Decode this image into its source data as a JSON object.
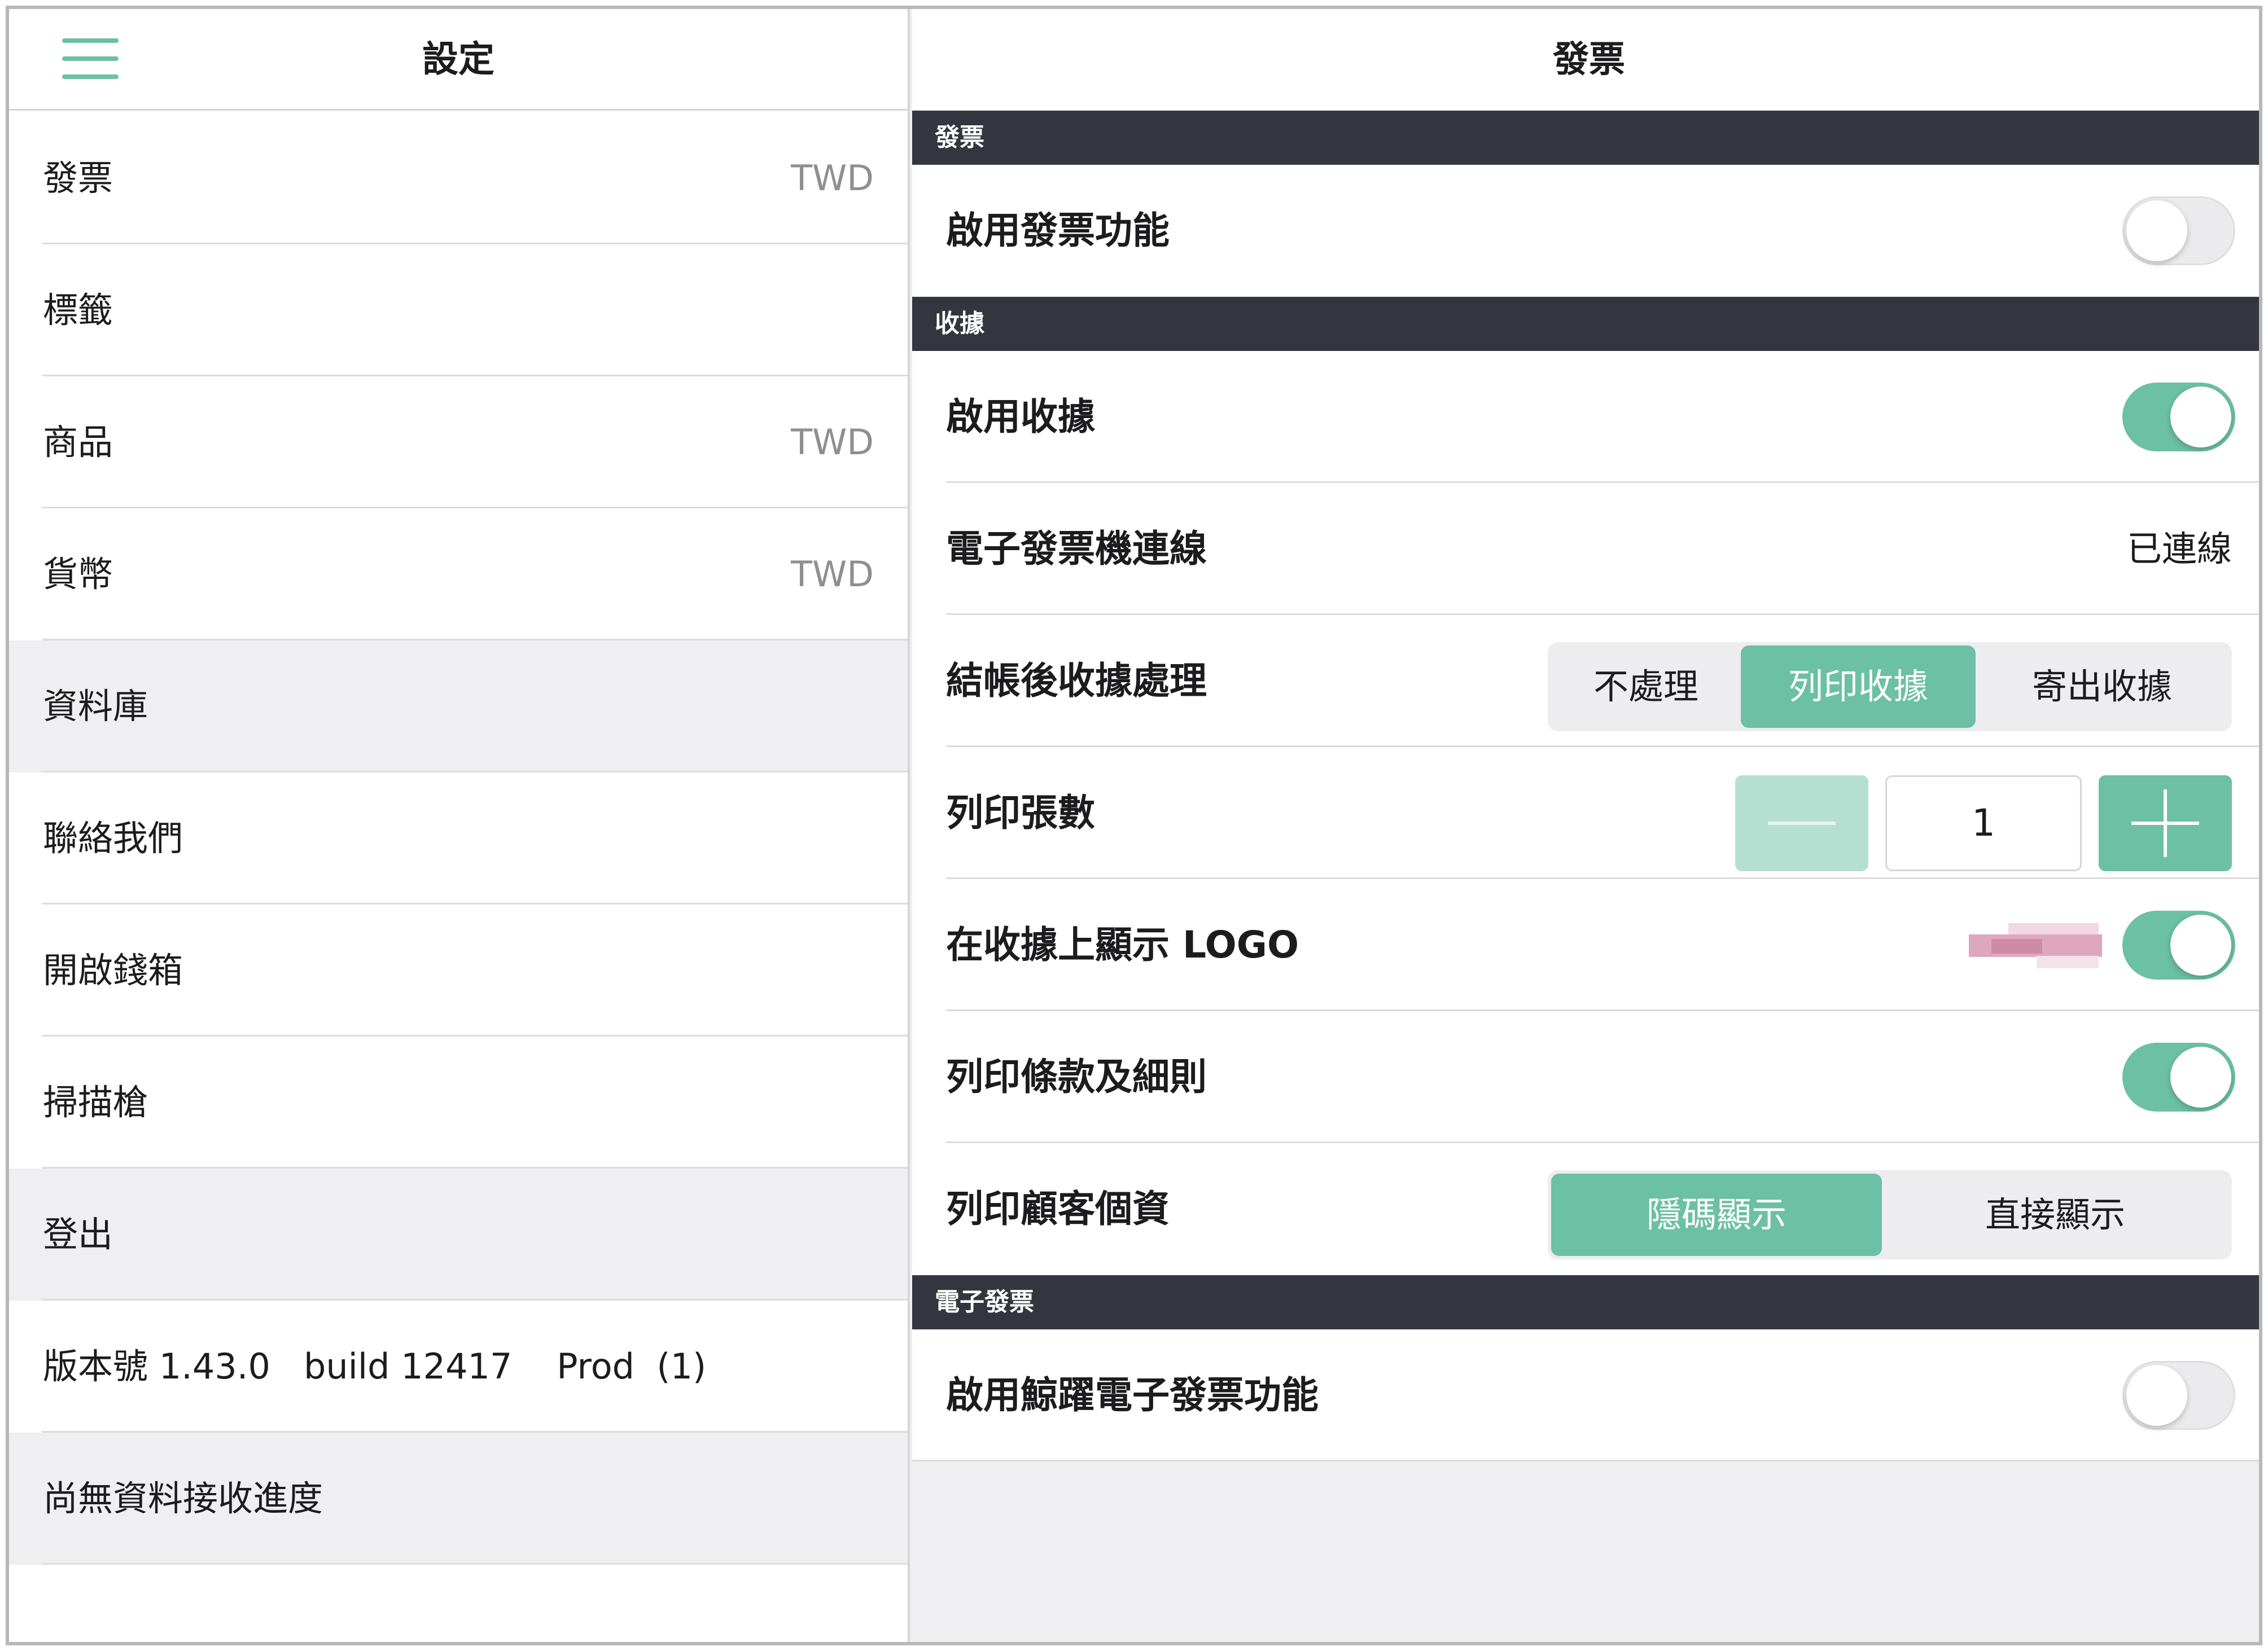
{
  "left": {
    "title": "設定",
    "items": [
      {
        "label": "發票",
        "value": "TWD"
      },
      {
        "label": "標籤",
        "value": ""
      },
      {
        "label": "商品",
        "value": "TWD"
      },
      {
        "label": "貨幣",
        "value": "TWD"
      },
      {
        "label": "資料庫",
        "value": ""
      },
      {
        "label": "聯絡我們",
        "value": ""
      },
      {
        "label": "開啟錢箱",
        "value": ""
      },
      {
        "label": "掃描槍",
        "value": ""
      },
      {
        "label": "登出",
        "value": ""
      },
      {
        "label": "版本號 1.43.0   build 12417    Prod  (1)",
        "value": ""
      },
      {
        "label": "尚無資料接收進度",
        "value": ""
      }
    ]
  },
  "right": {
    "title": "發票",
    "sections": {
      "invoice": "發票",
      "receipt": "收據",
      "einvoice": "電子發票"
    },
    "enable_invoice": {
      "label": "啟用發票功能",
      "on": false
    },
    "enable_receipt": {
      "label": "啟用收據",
      "on": true
    },
    "einvoice_connection": {
      "label": "電子發票機連線",
      "status": "已連線"
    },
    "after_checkout": {
      "label": "結帳後收據處理",
      "options": [
        "不處理",
        "列印收據",
        "寄出收據"
      ],
      "selected": "列印收據"
    },
    "print_copies": {
      "label": "列印張數",
      "value": "1"
    },
    "show_logo": {
      "label": "在收據上顯示 LOGO",
      "on": true
    },
    "print_terms": {
      "label": "列印條款及細則",
      "on": true
    },
    "print_customer": {
      "label": "列印顧客個資",
      "options": [
        "隱碼顯示",
        "直接顯示"
      ],
      "selected": "隱碼顯示"
    },
    "enable_whale_einvoice": {
      "label": "啟用鯨躍電子發票功能",
      "on": false
    }
  },
  "colors": {
    "accent": "#6cc0a3",
    "section_header": "#33363e",
    "secondary_text": "#8e8e93"
  }
}
